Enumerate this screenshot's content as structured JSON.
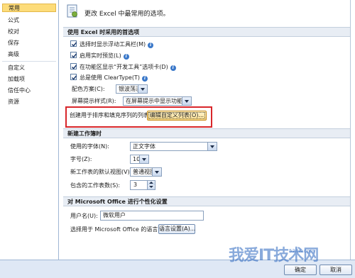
{
  "sidebar": {
    "items": [
      "常用",
      "公式",
      "校对",
      "保存",
      "高级",
      "自定义",
      "加载项",
      "信任中心",
      "资源"
    ]
  },
  "header": {
    "text": "更改 Excel 中最常用的选项。"
  },
  "sections": {
    "top": "使用 Excel 时采用的首选项",
    "new_workbook": "新建工作簿时",
    "personalize": "对 Microsoft Office 进行个性化设置"
  },
  "checkboxes": [
    {
      "label": "选择时显示浮动工具栏(M)",
      "checked": true
    },
    {
      "label": "启用实时预览(L)",
      "checked": true
    },
    {
      "label": "在功能区显示“开发工具”选项卡(D)",
      "checked": true
    },
    {
      "label": "总是使用 ClearType(T)",
      "checked": true
    }
  ],
  "color_scheme": {
    "label": "配色方案(C):",
    "value": "银波荡漾"
  },
  "screentip": {
    "label": "屏幕提示样式(R):",
    "value": "在屏幕提示中显示功能说明"
  },
  "custom_lists": {
    "label": "创建用于排序和填充序列的列表:",
    "button": "编辑自定义列表(O)..."
  },
  "font": {
    "label": "使用的字体(N):",
    "value": "正文字体"
  },
  "font_size": {
    "label": "字号(Z):",
    "value": "10"
  },
  "default_view": {
    "label": "新工作表的默认视图(V):",
    "value": "普通视图"
  },
  "sheet_count": {
    "label": "包含的工作表数(S):",
    "value": "3"
  },
  "user_name": {
    "label": "用户名(U):",
    "value": "微软用户"
  },
  "language": {
    "label": "选择用于 Microsoft Office 的语言:",
    "button": "语言设置(A)..."
  },
  "footer": {
    "ok": "确定",
    "cancel": "取消"
  },
  "watermark": {
    "main": "我爱IT技术网",
    "sub": "52itw.com"
  },
  "colors": {
    "highlight": "#d8262a",
    "selected_nav": "#fddc7a"
  }
}
